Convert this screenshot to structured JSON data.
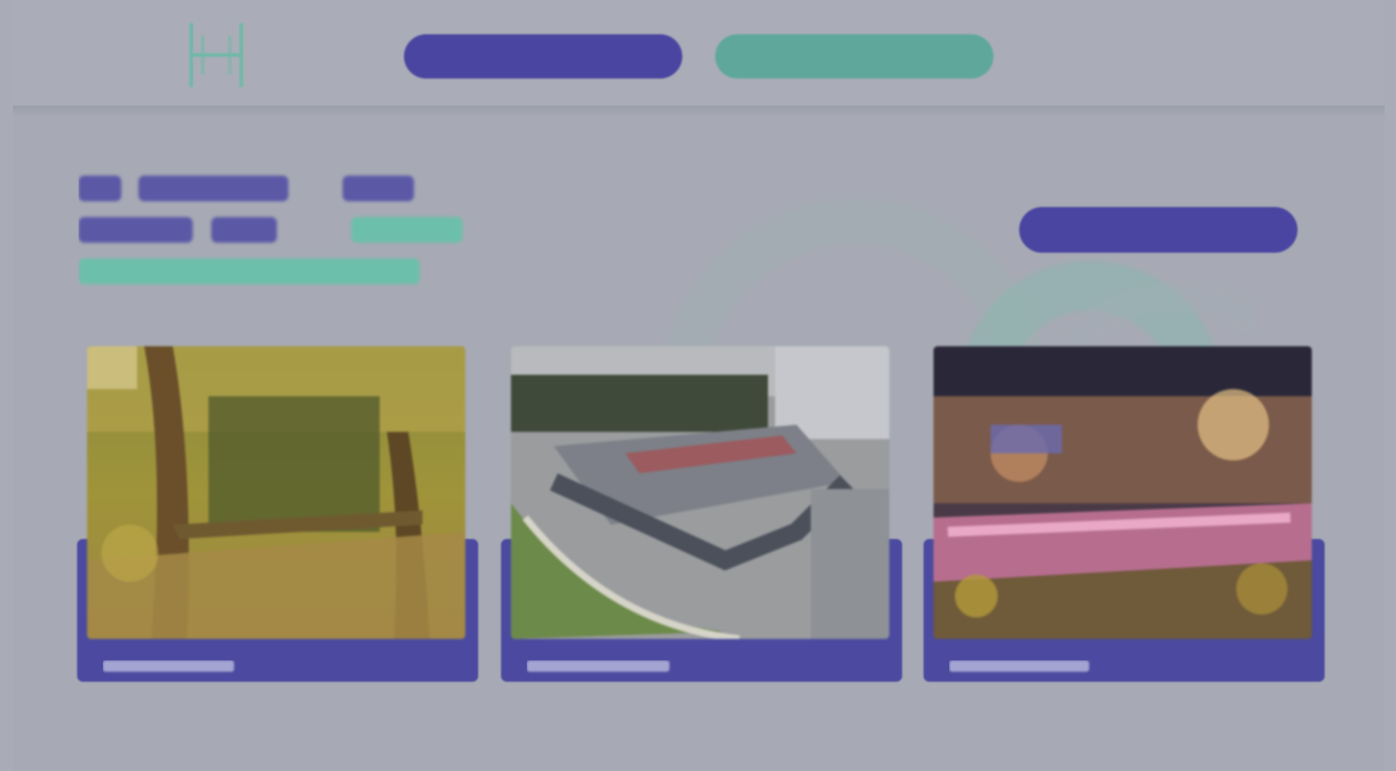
{
  "header": {
    "logo_name": "H",
    "primary_button_label": "",
    "secondary_button_label": "",
    "language": ""
  },
  "hero": {
    "line1": "",
    "line2": "",
    "line3": "",
    "cta_label": ""
  },
  "cards": [
    {
      "label": "",
      "image": "park-path-autumn"
    },
    {
      "label": "",
      "image": "aerial-building-complex"
    },
    {
      "label": "",
      "image": "night-illuminated-venue"
    }
  ],
  "colors": {
    "primary": "#4a45a0",
    "accent": "#5fa79b",
    "background": "#a7aab4"
  }
}
